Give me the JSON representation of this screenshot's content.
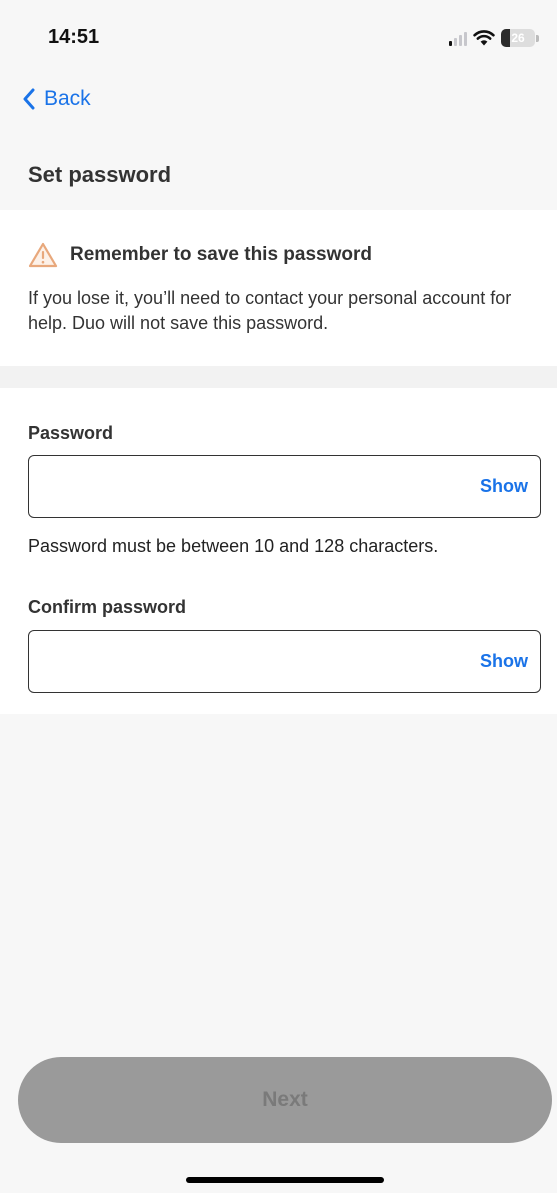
{
  "status_bar": {
    "time": "14:51",
    "battery_level": "26",
    "battery_fraction": 0.26,
    "signal_icon": "cellular-signal-icon",
    "wifi_icon": "wifi-icon"
  },
  "nav": {
    "back_label": "Back",
    "back_icon": "chevron-left-icon"
  },
  "page": {
    "title": "Set password"
  },
  "notice": {
    "icon": "warning-icon",
    "icon_color": "#e8a87c",
    "title": "Remember to save this password",
    "body": "If you lose it, you’ll need to contact your personal account for help. Duo will not save this password."
  },
  "form": {
    "password": {
      "label": "Password",
      "value": "",
      "toggle_label": "Show",
      "helper": "Password must be between 10 and 128 characters."
    },
    "confirm_password": {
      "label": "Confirm password",
      "value": "",
      "toggle_label": "Show"
    }
  },
  "actions": {
    "next_label": "Next"
  },
  "colors": {
    "accent": "#1a73e8",
    "disabled_button": "#9a9a9a"
  }
}
